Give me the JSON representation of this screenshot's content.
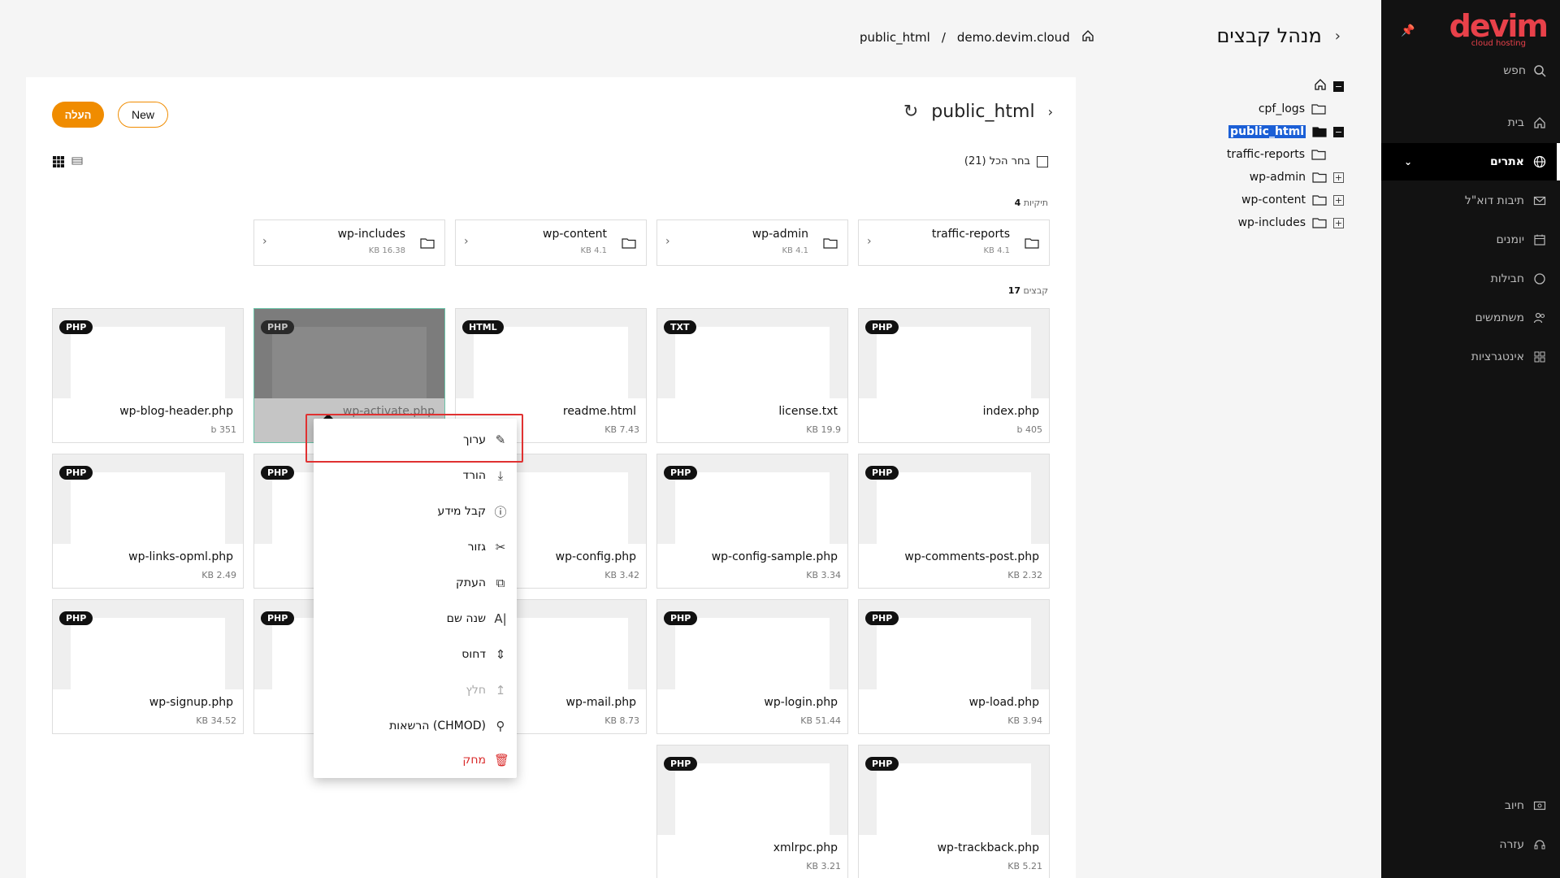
{
  "app": {
    "logo_text": "devim",
    "logo_sub": "cloud hosting",
    "page_title": "מנהל קבצים"
  },
  "sidebar": {
    "search_label": "חפש",
    "items": [
      {
        "label": "בית",
        "icon": "home-icon"
      },
      {
        "label": "אתרים",
        "icon": "globe-icon",
        "active": true
      },
      {
        "label": "תיבות דוא\"ל",
        "icon": "mail-icon"
      },
      {
        "label": "יומנים",
        "icon": "calendar-icon"
      },
      {
        "label": "חבילות",
        "icon": "circle-icon"
      },
      {
        "label": "משתמשים",
        "icon": "users-icon"
      },
      {
        "label": "אינטגרציות",
        "icon": "grid-icon"
      }
    ],
    "bottom": [
      {
        "label": "חיוב",
        "icon": "billing-icon"
      },
      {
        "label": "עזרה",
        "icon": "help-icon"
      }
    ]
  },
  "breadcrumb": {
    "home": "demo.devim.cloud",
    "sep": "/",
    "current": "public_html"
  },
  "tree": [
    {
      "label": "cpf_logs",
      "toggle": ""
    },
    {
      "label": "public_html",
      "toggle": "−",
      "selected": true
    },
    {
      "label": "traffic-reports",
      "toggle": ""
    },
    {
      "label": "wp-admin",
      "toggle": "+"
    },
    {
      "label": "wp-content",
      "toggle": "+"
    },
    {
      "label": "wp-includes",
      "toggle": "+"
    }
  ],
  "toolbar": {
    "upload_label": "העלה",
    "new_label": "New",
    "folder_title": "public_html",
    "select_all": "בחר הכל (21)"
  },
  "sections": {
    "folders_count": "4",
    "folders_label": "תיקיות",
    "files_count": "17",
    "files_label": "קבצים"
  },
  "folders": [
    {
      "name": "traffic-reports",
      "size": "KB 4.1"
    },
    {
      "name": "wp-admin",
      "size": "KB 4.1"
    },
    {
      "name": "wp-content",
      "size": "KB 4.1"
    },
    {
      "name": "wp-includes",
      "size": "KB 16.38"
    }
  ],
  "files": [
    {
      "name": "index.php",
      "size": "b 405",
      "type": "PHP"
    },
    {
      "name": "license.txt",
      "size": "KB 19.9",
      "type": "TXT"
    },
    {
      "name": "readme.html",
      "size": "KB 7.43",
      "type": "HTML"
    },
    {
      "name": "wp-activate.php",
      "size": "",
      "type": "PHP",
      "selected": true
    },
    {
      "name": "wp-blog-header.php",
      "size": "b 351",
      "type": "PHP"
    },
    {
      "name": "wp-comments-post.php",
      "size": "KB 2.32",
      "type": "PHP"
    },
    {
      "name": "wp-config-sample.php",
      "size": "KB 3.34",
      "type": "PHP"
    },
    {
      "name": "wp-config.php",
      "size": "KB 3.42",
      "type": ""
    },
    {
      "name": "",
      "size": "",
      "type": "PHP"
    },
    {
      "name": "wp-links-opml.php",
      "size": "KB 2.49",
      "type": "PHP"
    },
    {
      "name": "wp-load.php",
      "size": "KB 3.94",
      "type": "PHP"
    },
    {
      "name": "wp-login.php",
      "size": "KB 51.44",
      "type": "PHP"
    },
    {
      "name": "wp-mail.php",
      "size": "KB 8.73",
      "type": ""
    },
    {
      "name": "",
      "size": "",
      "type": "PHP"
    },
    {
      "name": "wp-signup.php",
      "size": "KB 34.52",
      "type": "PHP"
    },
    {
      "name": "wp-trackback.php",
      "size": "KB 5.21",
      "type": "PHP"
    },
    {
      "name": "xmlrpc.php",
      "size": "KB 3.21",
      "type": "PHP"
    }
  ],
  "context_menu": [
    {
      "label": "ערוך",
      "icon": "pencil-icon"
    },
    {
      "label": "הורד",
      "icon": "download-icon"
    },
    {
      "label": "קבל מידע",
      "icon": "info-icon"
    },
    {
      "label": "גזור",
      "icon": "scissors-icon"
    },
    {
      "label": "העתק",
      "icon": "copy-icon"
    },
    {
      "label": "שנה שם",
      "icon": "rename-icon"
    },
    {
      "label": "דחוס",
      "icon": "compress-icon"
    },
    {
      "label": "חלץ",
      "icon": "extract-icon",
      "disabled": true
    },
    {
      "label": "הרשאות (CHMOD)",
      "icon": "key-icon"
    },
    {
      "label": "מחק",
      "icon": "trash-icon",
      "danger": true
    }
  ]
}
